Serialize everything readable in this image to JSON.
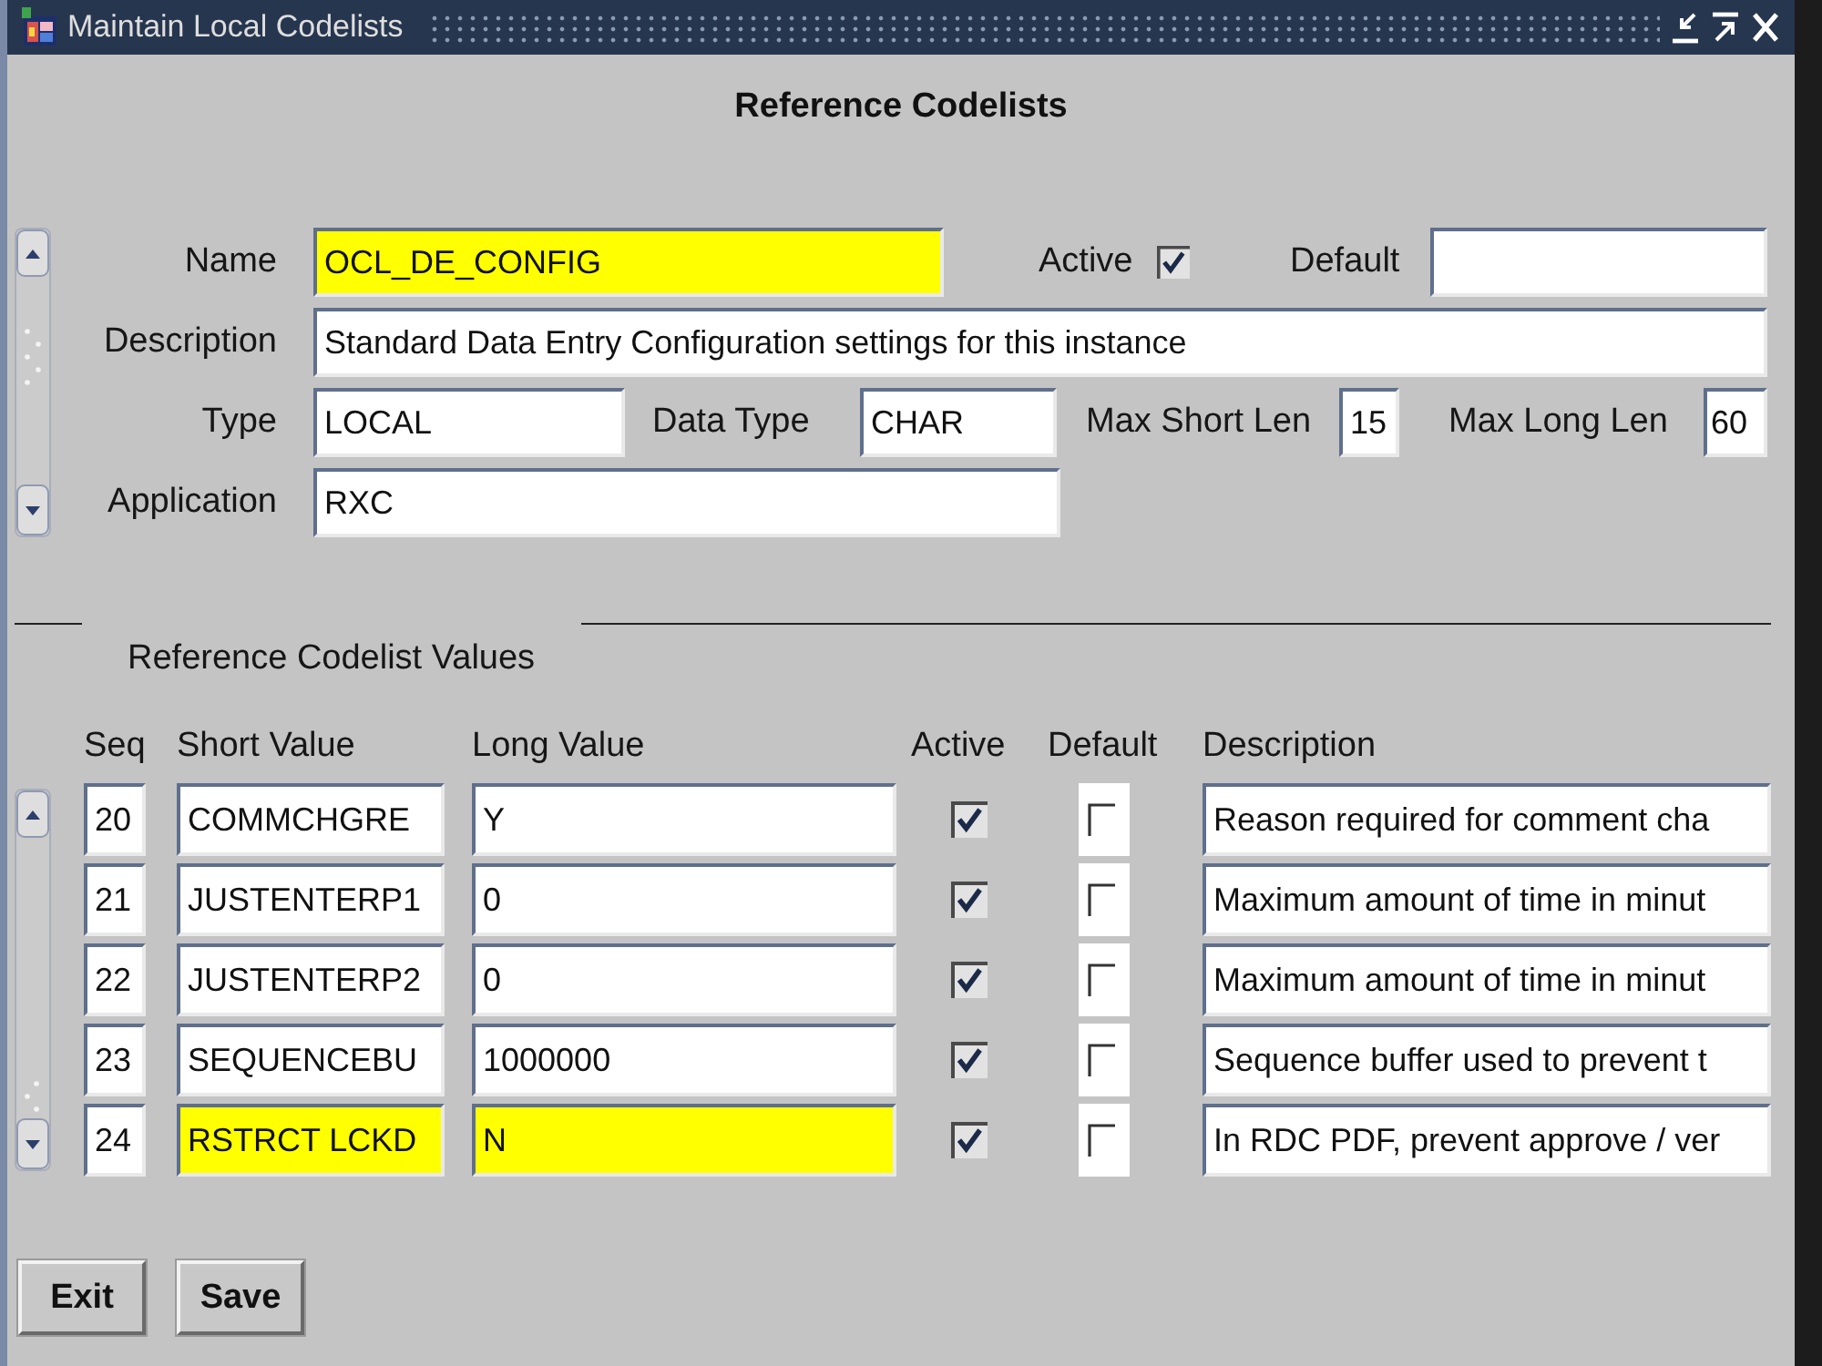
{
  "window": {
    "title": "Maintain Local Codelists"
  },
  "heading": "Reference Codelists",
  "codelist": {
    "name": {
      "label": "Name",
      "value": "OCL_DE_CONFIG",
      "current": true
    },
    "active": {
      "label": "Active",
      "checked": true
    },
    "default": {
      "label": "Default"
    },
    "description": {
      "label": "Description",
      "value": "Standard Data Entry Configuration settings for this instance"
    },
    "type": {
      "label": "Type",
      "value": "LOCAL"
    },
    "data_type": {
      "label": "Data Type",
      "value": "CHAR"
    },
    "max_short_len": {
      "label": "Max Short Len",
      "value": "15"
    },
    "max_long_len": {
      "label": "Max Long Len",
      "value": "60"
    },
    "application": {
      "label": "Application",
      "value": "RXC"
    }
  },
  "values": {
    "title": "Reference Codelist Values",
    "columns": [
      "Seq",
      "Short Value",
      "Long Value",
      "Active",
      "Default",
      "Description"
    ],
    "rows": [
      {
        "seq": "20",
        "short_value": "COMMCHGRE",
        "long_value": "Y",
        "active": true,
        "default": false,
        "description": "Reason required for comment cha",
        "selected": false
      },
      {
        "seq": "21",
        "short_value": "JUSTENTERP1",
        "long_value": "0",
        "active": true,
        "default": false,
        "description": "Maximum amount of time in minut",
        "selected": false
      },
      {
        "seq": "22",
        "short_value": "JUSTENTERP2",
        "long_value": "0",
        "active": true,
        "default": false,
        "description": "Maximum amount of time in minut",
        "selected": false
      },
      {
        "seq": "23",
        "short_value": "SEQUENCEBU",
        "long_value": "1000000",
        "active": true,
        "default": false,
        "description": "Sequence buffer used to prevent t",
        "selected": false
      },
      {
        "seq": "24",
        "short_value": "RSTRCT LCKD",
        "long_value": "N",
        "active": true,
        "default": false,
        "description": "In RDC PDF, prevent approve / ver",
        "selected": true
      }
    ]
  },
  "buttons": [
    "Exit",
    "Save"
  ]
}
